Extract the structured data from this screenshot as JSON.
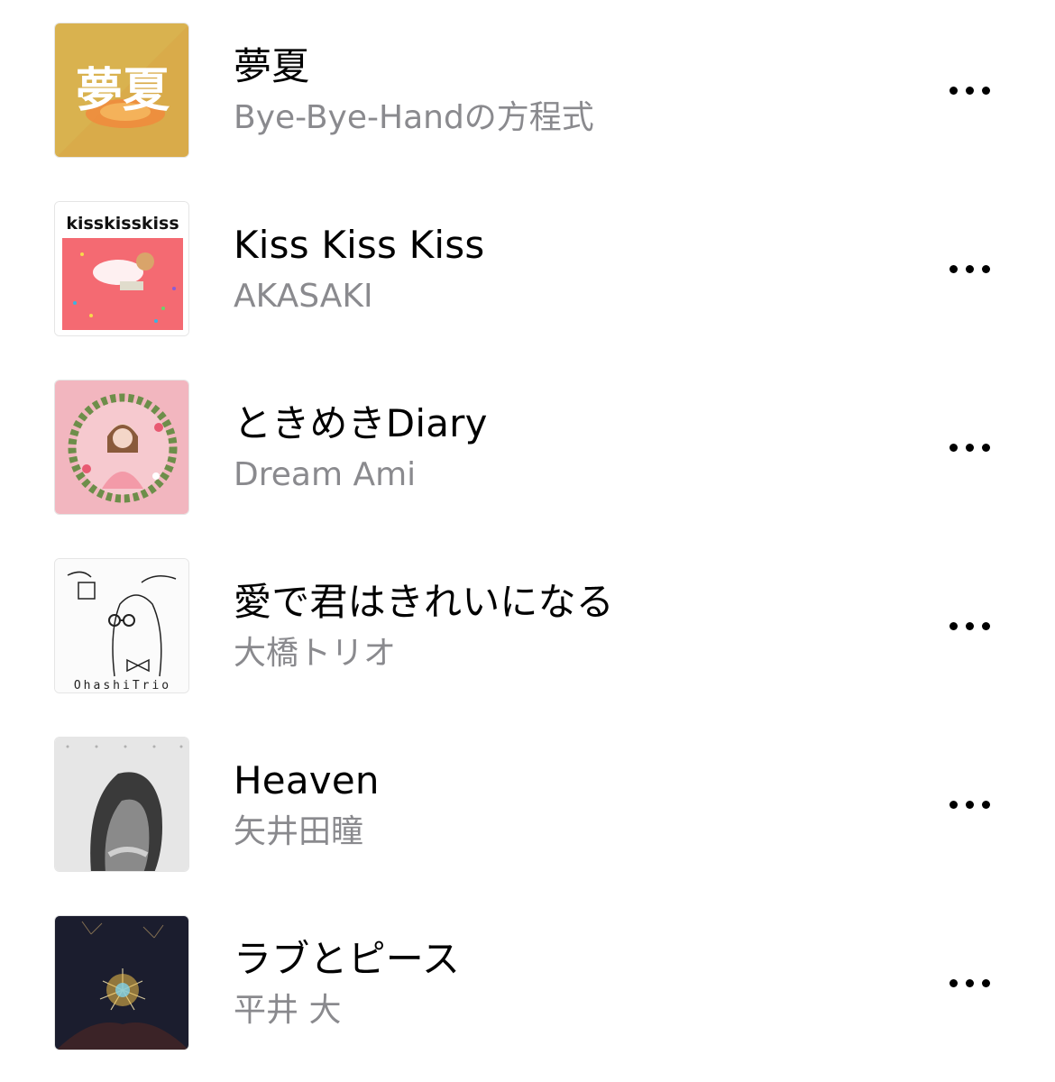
{
  "songs": [
    {
      "title": "夢夏",
      "artist": "Bye-Bye-Handの方程式",
      "artwork_icon": "yumenatsu-album-art",
      "artwork_text": "夢夏"
    },
    {
      "title": "Kiss Kiss Kiss",
      "artist": "AKASAKI",
      "artwork_icon": "kisskisskiss-album-art",
      "artwork_text": "kisskisskiss"
    },
    {
      "title": "ときめきDiary",
      "artist": "Dream Ami",
      "artwork_icon": "tokimeki-diary-album-art",
      "artwork_text": ""
    },
    {
      "title": "愛で君はきれいになる",
      "artist": "大橋トリオ",
      "artwork_icon": "ohashi-trio-album-art",
      "artwork_text": "OhashiTrio"
    },
    {
      "title": "Heaven",
      "artist": "矢井田瞳",
      "artwork_icon": "heaven-album-art",
      "artwork_text": ""
    },
    {
      "title": "ラブとピース",
      "artist": "平井 大",
      "artwork_icon": "love-and-peace-album-art",
      "artwork_text": ""
    }
  ],
  "more_icon": "more-ellipsis-icon",
  "colors": {
    "title": "#000000",
    "artist": "#8a8a8e",
    "background": "#ffffff"
  }
}
